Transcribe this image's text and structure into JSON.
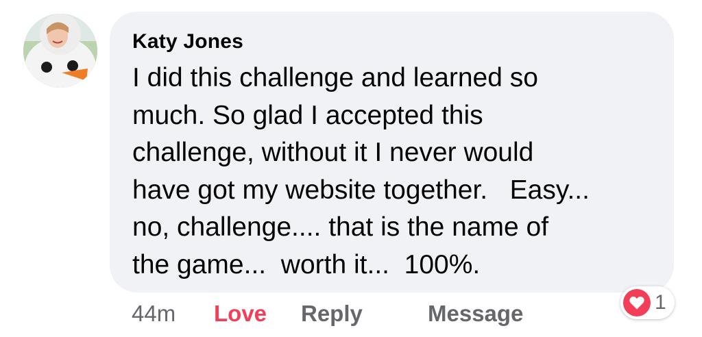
{
  "comment": {
    "author": "Katy Jones",
    "text": "I did this challenge and learned so\nmuch. So glad I accepted this\nchallenge, without it I never would\nhave got my website together.   Easy...\nno, challenge.... that is the name of\nthe game...  worth it...  100%."
  },
  "actions": {
    "timestamp": "44m",
    "love_label": "Love",
    "reply_label": "Reply",
    "message_label": "Message"
  },
  "reaction": {
    "icon": "heart-icon",
    "count": "1"
  },
  "colors": {
    "bubble_bg": "#f0f2f5",
    "love_accent": "#f33e58",
    "secondary_text": "#65676b"
  }
}
